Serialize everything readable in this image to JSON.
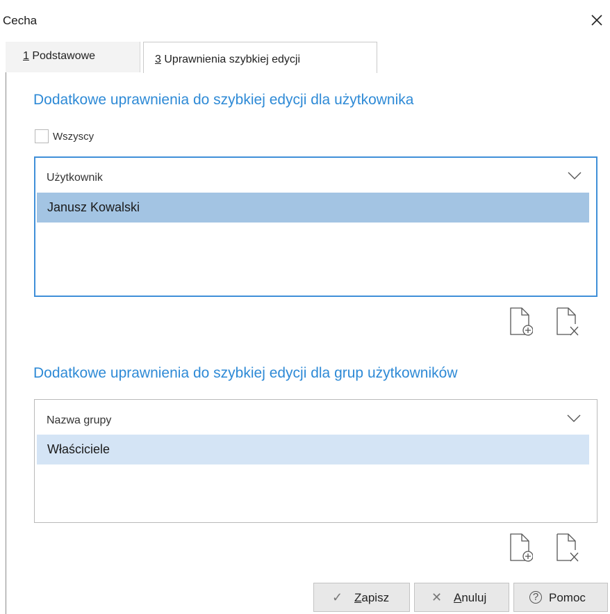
{
  "window": {
    "title": "Cecha"
  },
  "tabs": [
    {
      "number": "1",
      "label": "Podstawowe",
      "active": false
    },
    {
      "number": "3",
      "label": "Uprawnienia szybkiej edycji",
      "active": true
    }
  ],
  "users_section": {
    "title": "Dodatkowe uprawnienia do szybkiej edycji dla użytkownika",
    "all_checkbox": {
      "label": "Wszyscy",
      "checked": false
    },
    "column_header": "Użytkownik",
    "rows": [
      "Janusz Kowalski"
    ]
  },
  "groups_section": {
    "title": "Dodatkowe uprawnienia do szybkiej edycji dla grup użytkowników",
    "column_header": "Nazwa grupy",
    "rows": [
      "Właściciele"
    ]
  },
  "buttons": {
    "save": {
      "first": "Z",
      "rest": "apisz"
    },
    "cancel": {
      "first": "A",
      "rest": "nuluj"
    },
    "help": "Pomoc"
  },
  "colors": {
    "accent": "#2e8ad6",
    "selected_row": "#a3c4e3",
    "selected_row_inactive": "#d4e4f5"
  }
}
